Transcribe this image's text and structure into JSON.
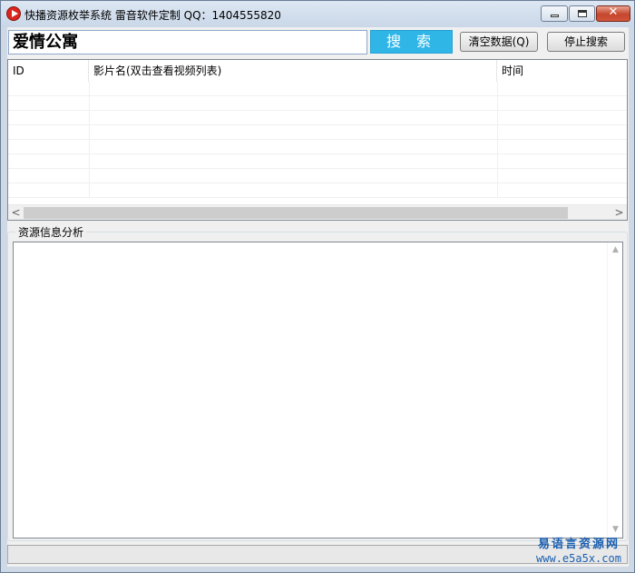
{
  "window": {
    "title": "快播资源枚举系统   雷音软件定制   QQ：1404555820",
    "icon": "play-icon",
    "controls": [
      "minimize-icon",
      "maximize-icon",
      "close-icon"
    ],
    "close_glyph": "✕"
  },
  "search": {
    "value": "爱情公寓",
    "button_label": "搜 索",
    "accent_color": "#2fb6e6"
  },
  "toolbar": {
    "clear_label": "清空数据(Q)",
    "stop_label": "停止搜索"
  },
  "results": {
    "columns": [
      "ID",
      "影片名(双击查看视频列表)",
      "时间"
    ],
    "rows": [],
    "scroll_left": "<",
    "scroll_right": ">"
  },
  "info_group": {
    "title": "资源信息分析",
    "content": "",
    "scroll_up": "▲",
    "scroll_down": "▼"
  },
  "watermark": {
    "line1": "易语言资源网",
    "line2": "www.e5a5x.com"
  }
}
